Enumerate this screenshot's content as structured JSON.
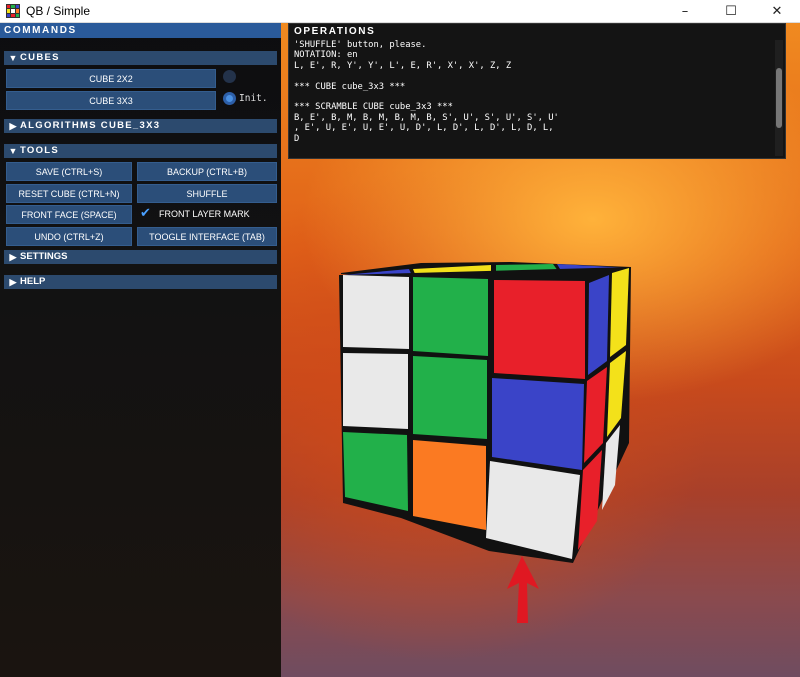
{
  "window": {
    "title": "QB / Simple",
    "minimize": "–",
    "maximize": "☐",
    "close": "✕"
  },
  "panel": {
    "header": "COMMANDS",
    "cubes": {
      "label": "CUBES",
      "buttons": [
        "CUBE 2X2",
        "CUBE 3X3"
      ],
      "radio_label": "Init."
    },
    "algorithms": {
      "label": "ALGORITHMS CUBE_3X3"
    },
    "tools": {
      "label": "TOOLS",
      "save": "SAVE (CTRL+S)",
      "backup": "BACKUP (CTRL+B)",
      "reset": "RESET CUBE (CTRL+N)",
      "shuffle": "SHUFFLE",
      "front_face": "FRONT FACE (SPACE)",
      "front_layer_mark": "FRONT LAYER MARK",
      "undo": "UNDO (CTRL+Z)",
      "toggle_interface": "TOOGLE INTERFACE (TAB)"
    },
    "settings": {
      "label": "SETTINGS"
    },
    "help": {
      "label": "HELP"
    }
  },
  "operations": {
    "title": "OPERATIONS",
    "lines": [
      "'SHUFFLE' button, please.",
      "NOTATION: en",
      "L, E', R, Y', Y', L', E, R', X', X', Z, Z",
      "",
      "*** CUBE cube_3x3 ***",
      "",
      "*** SCRAMBLE CUBE cube_3x3 ***",
      "B, E', B, M, B, M, B, M, B, S', U', S', U', S', U'",
      ", E', U, E', U, E', U, D', L, D', L, D', L, D, L,",
      "D"
    ]
  },
  "colors": {
    "white": "#e9e9e9",
    "green": "#22b04a",
    "red": "#e8202a",
    "blue": "#3a44c8",
    "orange": "#fb7a22",
    "yellow": "#f3e11a",
    "accent": "#2a5a9a",
    "button": "#2b4e79"
  }
}
